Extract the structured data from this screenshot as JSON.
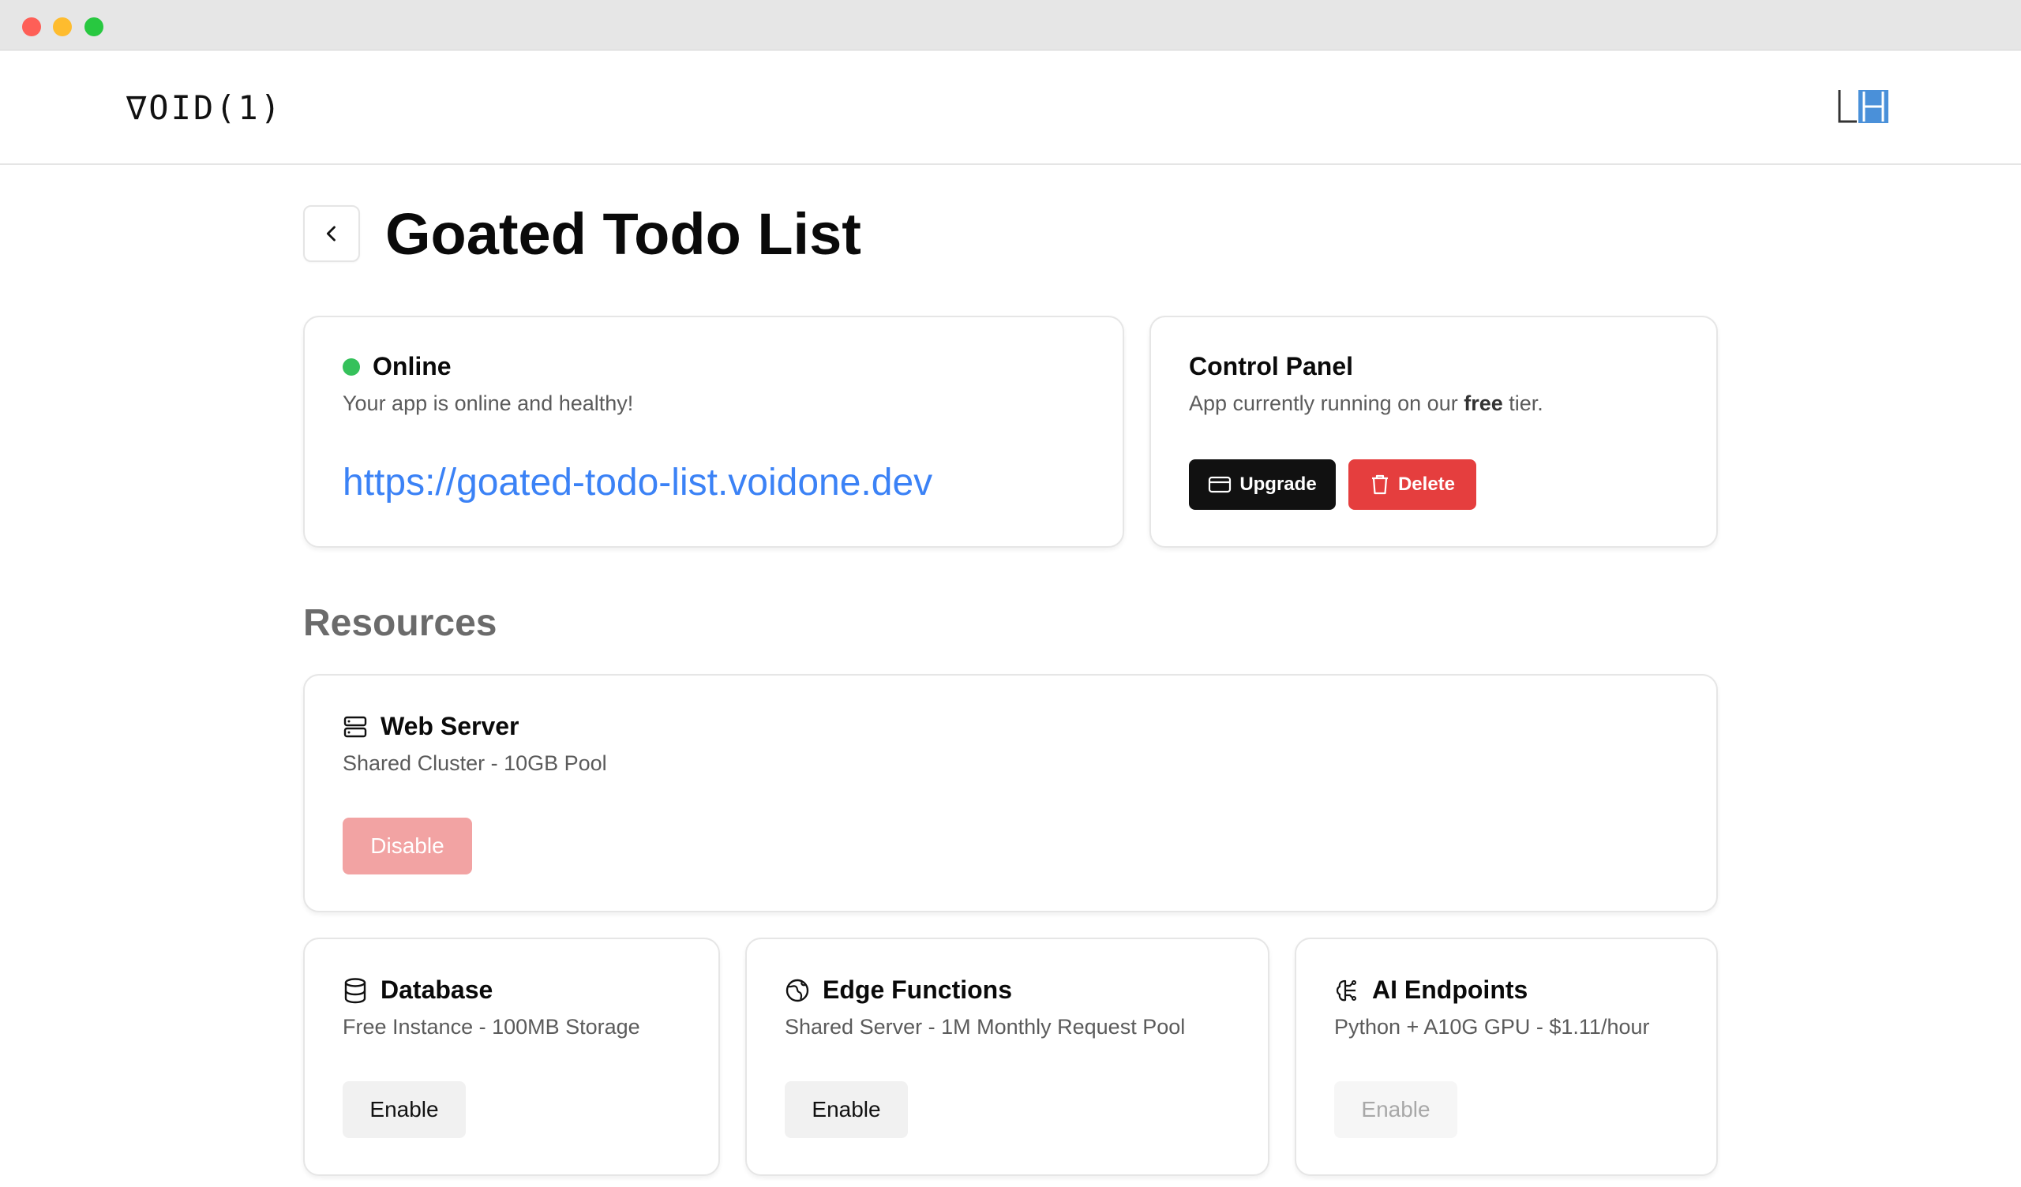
{
  "brand": {
    "logo_text": "∇OID(1)"
  },
  "page": {
    "title": "Goated Todo List"
  },
  "status_card": {
    "status": "Online",
    "message": "Your app is online and healthy!",
    "url": "https://goated-todo-list.voidone.dev",
    "status_color": "#35c15b"
  },
  "control_panel": {
    "title": "Control Panel",
    "message_prefix": "App currently running on our ",
    "tier": "free",
    "message_suffix": " tier.",
    "upgrade_label": "Upgrade",
    "delete_label": "Delete"
  },
  "resources": {
    "heading": "Resources",
    "web_server": {
      "title": "Web Server",
      "description": "Shared Cluster - 10GB Pool",
      "button_label": "Disable",
      "icon": "server-icon"
    },
    "database": {
      "title": "Database",
      "description": "Free Instance - 100MB Storage",
      "button_label": "Enable",
      "icon": "database-icon"
    },
    "edge_functions": {
      "title": "Edge Functions",
      "description": "Shared Server - 1M Monthly Request Pool",
      "button_label": "Enable",
      "icon": "globe-icon"
    },
    "ai_endpoints": {
      "title": "AI Endpoints",
      "description": "Python + A10G GPU - $1.11/hour",
      "button_label": "Enable",
      "icon": "brain-icon"
    }
  },
  "colors": {
    "accent_link": "#3b82f6",
    "danger": "#e53e3e",
    "primary_dark": "#111111"
  }
}
